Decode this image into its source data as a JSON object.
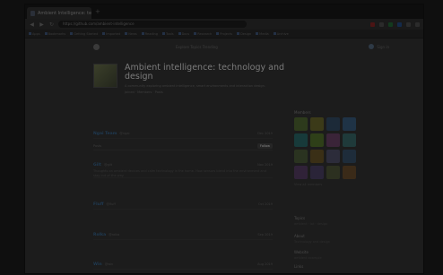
{
  "browser": {
    "tab_title": "Ambient Intelligence: techno",
    "new_tab": "+",
    "omnibox": "https://github.com/ambient-intelligence",
    "bookmarks": [
      "Apps",
      "Bookmarks",
      "Getting Started",
      "Imported",
      "News",
      "Reading",
      "Tools",
      "Docs",
      "Research",
      "Projects",
      "Design",
      "Media",
      "Archive"
    ]
  },
  "site": {
    "header_links": "Explore  Topics  Trending",
    "header_user": "Sign in"
  },
  "hero": {
    "title": "Ambient intelligence: technology and design",
    "subtitle": "A community exploring ambient intelligence, smart environments and interaction design.",
    "subtitle2": "Joined · Members · Posts"
  },
  "toolbar": {
    "label": "Posts",
    "follow": "Follow"
  },
  "posts": [
    {
      "name": "Ngai Team",
      "handle": "@ngai",
      "date": "Dec 2019",
      "body": ""
    },
    {
      "name": "Gilt",
      "handle": "@gilt",
      "date": "Nov 2019",
      "body": "Thoughts on ambient devices and calm technology in the home. How sensors blend into the environment and stay out of the way."
    },
    {
      "name": "Fluff",
      "handle": "@fluff",
      "date": "Oct 2019",
      "body": ""
    },
    {
      "name": "Rolka",
      "handle": "@rolka",
      "date": "Sep 2019",
      "body": ""
    },
    {
      "name": "Win",
      "handle": "@win",
      "date": "Aug 2019",
      "body": ""
    }
  ],
  "sidebar": {
    "members_title": "Members",
    "members_colors": [
      "#2d3a1c",
      "#3b3a18",
      "#1c2a38",
      "#1f3346",
      "#173a3a",
      "#2e3f18",
      "#3a2438",
      "#1f3a3a",
      "#2a3320",
      "#3a2f16",
      "#2c2c3a",
      "#1e2c3a",
      "#302238",
      "#2a2438",
      "#2c3020",
      "#3a2a18"
    ],
    "members_more": "View all members",
    "topics_label": "Topics",
    "topics_val": "ambient · iot · design",
    "about_label": "About",
    "about_val": "Technology and design",
    "website_label": "Website",
    "website_val": "ambient.example",
    "links_label": "Links",
    "links_val": "github"
  }
}
